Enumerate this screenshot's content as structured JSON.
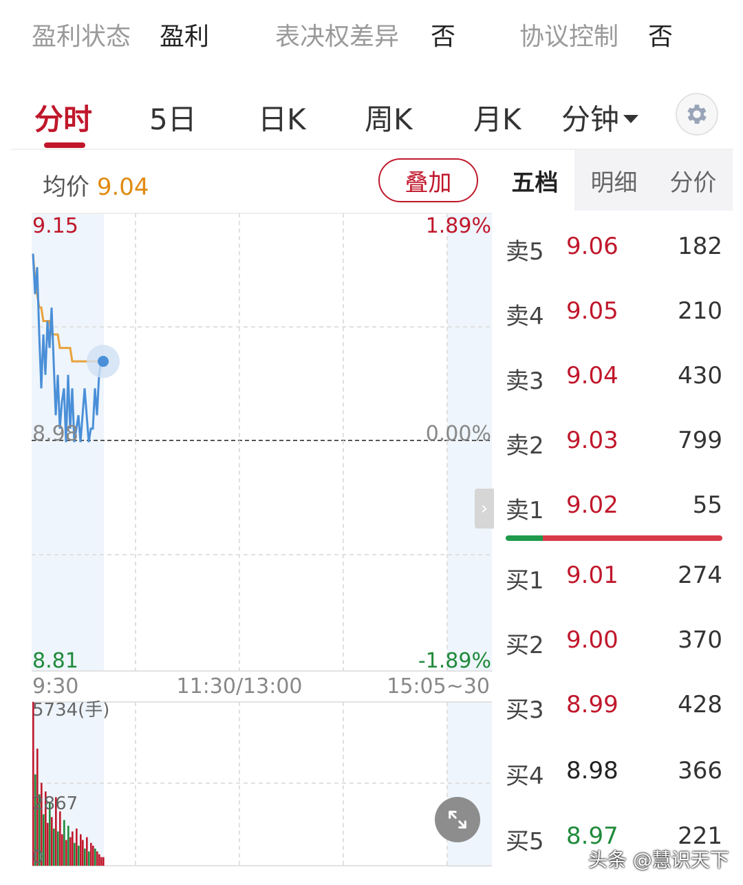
{
  "info": {
    "profit_label": "盈利状态",
    "profit_value": "盈利",
    "vote_label": "表决权差异",
    "vote_value": "否",
    "agreement_label": "协议控制",
    "agreement_value": "否"
  },
  "tabs": {
    "t1": "分时",
    "t2": "5日",
    "t3": "日K",
    "t4": "周K",
    "t5": "月K",
    "t6": "分钟"
  },
  "chart": {
    "avg_label": "均价",
    "avg_value": "9.04",
    "overlay_button": "叠加",
    "price_high": "9.15",
    "price_mid": "8.98",
    "price_low": "8.81",
    "pct_high": "1.89%",
    "pct_mid": "0.00%",
    "pct_low": "-1.89%",
    "time_start": "9:30",
    "time_mid": "11:30/13:00",
    "time_end": "15:05~30",
    "vol_max": "5734(手)",
    "vol_mid": "2867",
    "vol_zero": "0"
  },
  "colors": {
    "accent": "#c0172b",
    "price_line": "#4a8fd8",
    "avg_line": "#e8a23a",
    "up": "#c0172b",
    "down": "#1f8a3a"
  },
  "chart_data": {
    "type": "line",
    "ylim": [
      8.81,
      9.15
    ],
    "prev_close": 8.98,
    "price_series": [
      9.12,
      9.09,
      9.11,
      9.06,
      9.02,
      9.06,
      9.03,
      9.07,
      9.05,
      9.08,
      9.04,
      9.0,
      9.03,
      8.99,
      9.01,
      9.02,
      8.98,
      9.03,
      8.99,
      9.02,
      8.98,
      8.99,
      9.0,
      8.98,
      9.0,
      9.02,
      9.0,
      8.98,
      8.99,
      8.99,
      9.02,
      9.0,
      9.03,
      9.04,
      9.04
    ],
    "avg_series": [
      9.12,
      9.1,
      9.09,
      9.08,
      9.08,
      9.07,
      9.07,
      9.07,
      9.07,
      9.06,
      9.06,
      9.06,
      9.06,
      9.05,
      9.05,
      9.05,
      9.05,
      9.05,
      9.05,
      9.04,
      9.04,
      9.04,
      9.04,
      9.04,
      9.04,
      9.04,
      9.04,
      9.04,
      9.04,
      9.04,
      9.04,
      9.04,
      9.04,
      9.04,
      9.04
    ],
    "volume_max": 5734,
    "volumes": [
      5734,
      3200,
      4100,
      2500,
      2900,
      1800,
      2600,
      1500,
      2200,
      1700,
      1300,
      2400,
      1200,
      1900,
      1100,
      1600,
      900,
      1400,
      1000,
      1200,
      800,
      1300,
      700,
      1100,
      900,
      600,
      1000,
      500,
      800,
      700,
      600,
      500,
      400,
      300,
      300
    ],
    "volume_up": [
      true,
      false,
      true,
      false,
      true,
      false,
      true,
      true,
      false,
      true,
      false,
      true,
      false,
      true,
      true,
      false,
      true,
      false,
      true,
      true,
      false,
      true,
      false,
      true,
      true,
      false,
      true,
      false,
      true,
      true,
      false,
      true,
      true,
      true,
      true
    ]
  },
  "order_book": {
    "tabs": [
      "五档",
      "明细",
      "分价"
    ],
    "asks": [
      {
        "label": "卖5",
        "price": "9.06",
        "vol": "182"
      },
      {
        "label": "卖4",
        "price": "9.05",
        "vol": "210"
      },
      {
        "label": "卖3",
        "price": "9.04",
        "vol": "430"
      },
      {
        "label": "卖2",
        "price": "9.03",
        "vol": "799"
      },
      {
        "label": "卖1",
        "price": "9.02",
        "vol": "55"
      }
    ],
    "bids": [
      {
        "label": "买1",
        "price": "9.01",
        "vol": "274"
      },
      {
        "label": "买2",
        "price": "9.00",
        "vol": "370"
      },
      {
        "label": "买3",
        "price": "8.99",
        "vol": "428"
      },
      {
        "label": "买4",
        "price": "8.98",
        "vol": "366"
      },
      {
        "label": "买5",
        "price": "8.97",
        "vol": "221"
      }
    ],
    "buy_ratio": 0.17
  },
  "watermark": "头条 @慧识天下"
}
